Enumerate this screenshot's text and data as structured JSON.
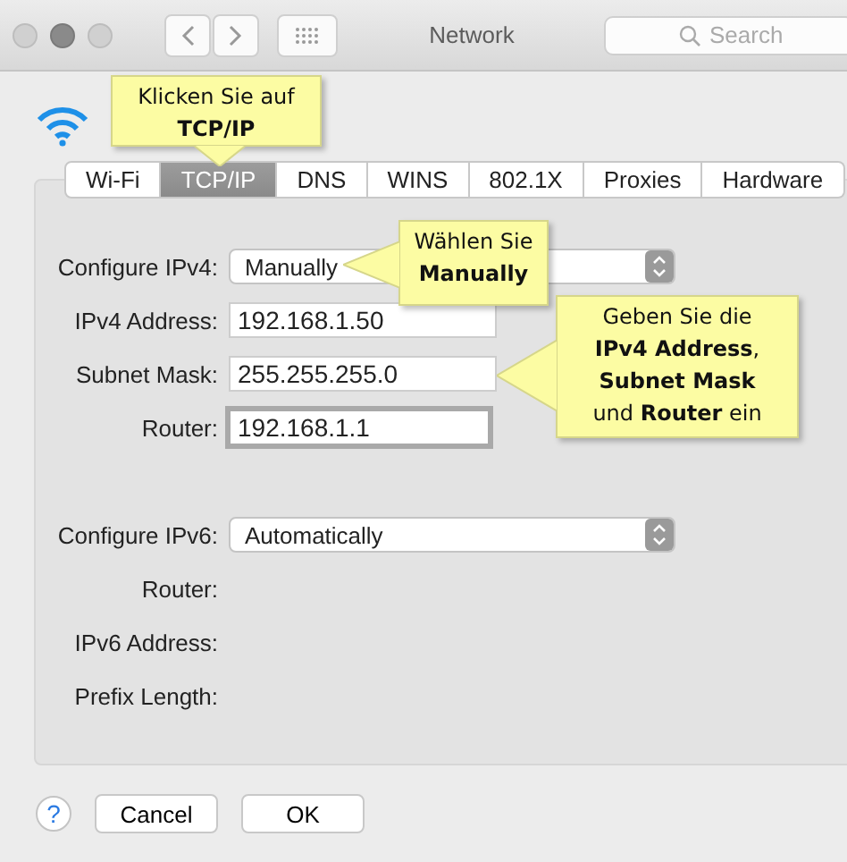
{
  "window": {
    "title": "Network",
    "search": {
      "placeholder": "Search"
    }
  },
  "tabs": [
    {
      "label": "Wi-Fi",
      "selected": false
    },
    {
      "label": "TCP/IP",
      "selected": true
    },
    {
      "label": "DNS",
      "selected": false
    },
    {
      "label": "WINS",
      "selected": false
    },
    {
      "label": "802.1X",
      "selected": false
    },
    {
      "label": "Proxies",
      "selected": false
    },
    {
      "label": "Hardware",
      "selected": false
    }
  ],
  "ipv4": [
    {
      "kind": "popup",
      "label": "Configure IPv4:",
      "value": "Manually"
    },
    {
      "kind": "field",
      "label": "IPv4 Address:",
      "value": "192.168.1.50",
      "focused": false
    },
    {
      "kind": "field",
      "label": "Subnet Mask:",
      "value": "255.255.255.0",
      "focused": false
    },
    {
      "kind": "field",
      "label": "Router:",
      "value": "192.168.1.1",
      "focused": true
    }
  ],
  "ipv6": [
    {
      "kind": "popup",
      "label": "Configure IPv6:",
      "value": "Automatically"
    },
    {
      "kind": "label",
      "label": "Router:"
    },
    {
      "kind": "label",
      "label": "IPv6 Address:"
    },
    {
      "kind": "label",
      "label": "Prefix Length:"
    }
  ],
  "help": "?",
  "buttons": [
    "Cancel",
    "OK"
  ],
  "callouts": [
    {
      "text": "Klicken Sie auf\n**TCP/IP**"
    },
    {
      "text": "Wählen Sie\n**Manually**"
    },
    {
      "text": "Geben Sie die\n**IPv4 Address**,\n**Subnet Mask**\nund **Router** ein"
    }
  ]
}
